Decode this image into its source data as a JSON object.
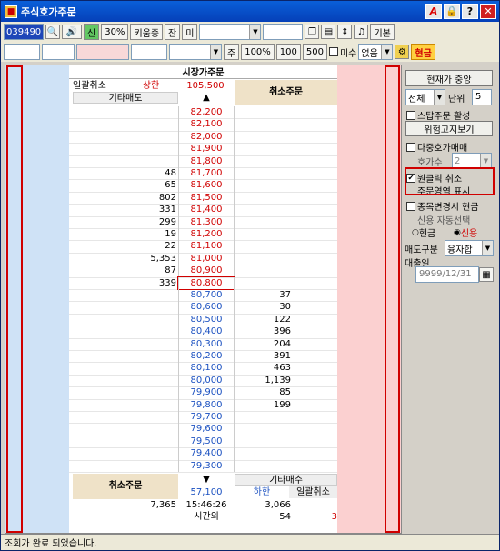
{
  "window": {
    "title": "주식호가주문"
  },
  "toolbar1": {
    "code": "039490",
    "sin": "신",
    "pct": "30%",
    "broker": "키움증",
    "jan": "잔",
    "mi": "미",
    "basic": "기본"
  },
  "toolbar2": {
    "ju": "주",
    "p100": "100%",
    "n100": "100",
    "n500": "500",
    "misu": "미수",
    "none": "없음",
    "cash": "현금"
  },
  "grid": {
    "market_order": "시장가주문",
    "cancel_all_left": "일괄취소",
    "upper_label": "상한",
    "upper_price": "105,500",
    "etc_sell": "기타매도",
    "cancel_order_top": "취소주문",
    "up_arrow": "▲",
    "cancel_order_bottom": "취소주문",
    "down_arrow": "▼",
    "etc_buy": "기타매수",
    "lower_price": "57,100",
    "lower_label": "하한",
    "cancel_all_right": "일괄취소",
    "total_sell": "7,365",
    "time": "15:46:26",
    "total_buy": "3,066",
    "after_hours": "시간외",
    "after_qty": "54",
    "after_val": "3",
    "sell_rows": [
      {
        "price": "82,200",
        "qty": ""
      },
      {
        "price": "82,100",
        "qty": ""
      },
      {
        "price": "82,000",
        "qty": ""
      },
      {
        "price": "81,900",
        "qty": ""
      },
      {
        "price": "81,800",
        "qty": ""
      },
      {
        "price": "81,700",
        "qty": "48"
      },
      {
        "price": "81,600",
        "qty": "65"
      },
      {
        "price": "81,500",
        "qty": "802"
      },
      {
        "price": "81,400",
        "qty": "331"
      },
      {
        "price": "81,300",
        "qty": "299"
      },
      {
        "price": "81,200",
        "qty": "19"
      },
      {
        "price": "81,100",
        "qty": "22"
      },
      {
        "price": "81,000",
        "qty": "5,353"
      },
      {
        "price": "80,900",
        "qty": "87"
      },
      {
        "price": "80,800",
        "qty": "339"
      }
    ],
    "buy_rows": [
      {
        "price": "80,700",
        "qty": "37"
      },
      {
        "price": "80,600",
        "qty": "30"
      },
      {
        "price": "80,500",
        "qty": "122"
      },
      {
        "price": "80,400",
        "qty": "396"
      },
      {
        "price": "80,300",
        "qty": "204"
      },
      {
        "price": "80,200",
        "qty": "391"
      },
      {
        "price": "80,100",
        "qty": "463"
      },
      {
        "price": "80,000",
        "qty": "1,139"
      },
      {
        "price": "79,900",
        "qty": "85"
      },
      {
        "price": "79,800",
        "qty": "199"
      },
      {
        "price": "79,700",
        "qty": ""
      },
      {
        "price": "79,600",
        "qty": ""
      },
      {
        "price": "79,500",
        "qty": ""
      },
      {
        "price": "79,400",
        "qty": ""
      },
      {
        "price": "79,300",
        "qty": ""
      }
    ]
  },
  "right": {
    "center_button": "현재가 중앙",
    "all": "전체",
    "unit_label": "단위",
    "unit_value": "5",
    "stop_order": "스탑주문 활성",
    "risk_notice": "위험고지보기",
    "multi_hoga": "다중호가매매",
    "hoga_count_label": "호가수",
    "hoga_count": "2",
    "one_click": "원클릭 취소",
    "order_area": "주문영역 표시",
    "stock_change": "종목변경시 현금",
    "credit_auto": "신용 자동선택",
    "radio_cash": "현금",
    "radio_credit": "신용",
    "sell_type_label": "매도구분",
    "sell_type": "융자합",
    "loan_date_label": "대출일",
    "loan_date": "9999/12/31"
  },
  "status": {
    "text": "조회가 완료 되었습니다."
  }
}
